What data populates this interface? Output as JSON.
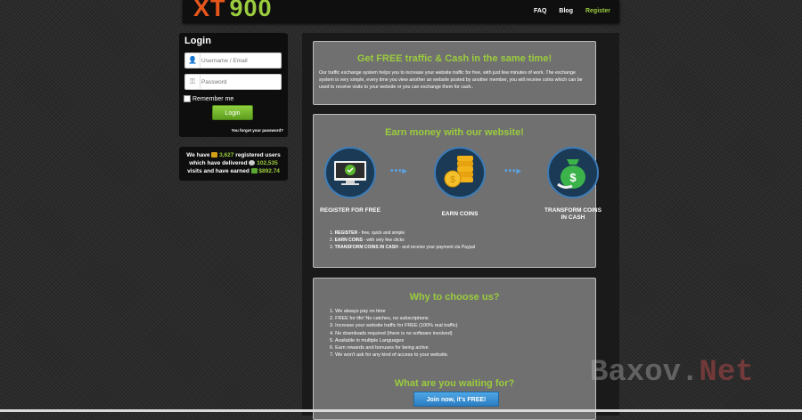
{
  "header": {
    "logo_xt": "XT",
    "logo_num": "900",
    "nav": [
      "FAQ",
      "Blog",
      "Register"
    ]
  },
  "login": {
    "title": "Login",
    "username_placeholder": "Username / Email",
    "password_placeholder": "Password",
    "remember": "Remember me",
    "button": "Login",
    "forgot": "You forgot your password?"
  },
  "stats": {
    "line1_pre": "We have",
    "users": "3,627",
    "line1_post": "registered users",
    "line2_pre": "which have delivered",
    "visits": "102,535",
    "line3_pre": "visits and have earned",
    "earned": "$892.74"
  },
  "intro": {
    "title": "Get FREE traffic & Cash in the same time!",
    "text": "Our traffic exchange system helps you to increase your website traffic for free, with just few minutes of work. The exchange system is very simple, every time you view another an website posted by another member, you will receive coins which can be used to receive visits to your website or you can exchange them for cash.."
  },
  "earn": {
    "title": "Earn money with our website!",
    "step_labels": [
      "REGISTER FOR FREE",
      "EARN COINS",
      "TRANSFORM COINS IN CASH"
    ],
    "steps": [
      {
        "bold": "REGISTER",
        "rest": " - free, quick and simple"
      },
      {
        "bold": "EARN COINS",
        "rest": " - with only few clicks"
      },
      {
        "bold": "TRANSFORM COINS IN CASH",
        "rest": " - and receive your payment via Paypal"
      }
    ]
  },
  "why": {
    "title": "Why to choose us?",
    "items": [
      "We always pay on time",
      "FREE for life! No catches, no subscriptions",
      "Increase your website traffic for FREE (100% real traffic)",
      "No downloads required (there is no software involved)",
      "Available in multiple Languages",
      "Earn rewards and bonuses for being active",
      "We won't ask for any kind of access to your website."
    ],
    "cta": "What are you waiting for?",
    "join": "Join now, it's FREE!"
  },
  "watermark": {
    "a": "Baxov.",
    "b": "Net"
  },
  "colors": {
    "accent_green": "#9bcc3d",
    "logo_orange": "#e8561b",
    "button_blue": "#2a7dc1"
  }
}
